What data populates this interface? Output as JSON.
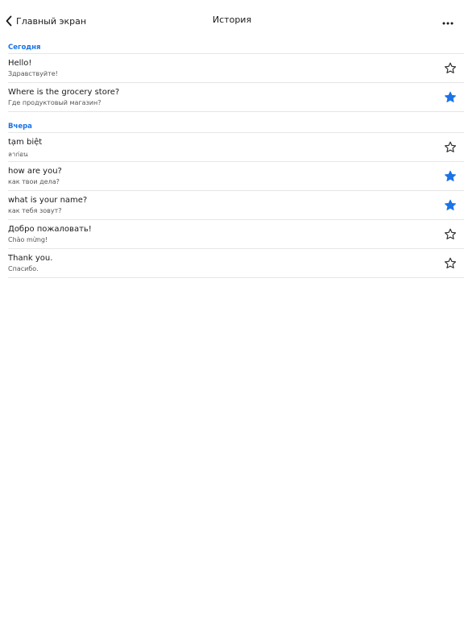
{
  "header": {
    "back_label": "Главный экран",
    "title": "История"
  },
  "colors": {
    "accent": "#1a73e8",
    "text": "#1a1a1a",
    "subtext": "#555555",
    "divider": "#e6e6e6",
    "star_outline": "#333333"
  },
  "sections": [
    {
      "label": "Сегодня",
      "items": [
        {
          "source": "Hello!",
          "translation": "Здравствуйте!",
          "starred": false
        },
        {
          "source": "Where is the grocery store?",
          "translation": "Где продуктовый магазин?",
          "starred": true
        }
      ]
    },
    {
      "label": "Вчера",
      "items": [
        {
          "source": "tạm biệt",
          "translation": "ลาก่อน",
          "starred": false
        },
        {
          "source": "how are you?",
          "translation": "как твои дела?",
          "starred": true
        },
        {
          "source": "what is your name?",
          "translation": "как тебя зовут?",
          "starred": true
        },
        {
          "source": "Добро пожаловать!",
          "translation": "Chào mừng!",
          "starred": false
        },
        {
          "source": "Thank you.",
          "translation": "Спасибо.",
          "starred": false
        }
      ]
    }
  ]
}
